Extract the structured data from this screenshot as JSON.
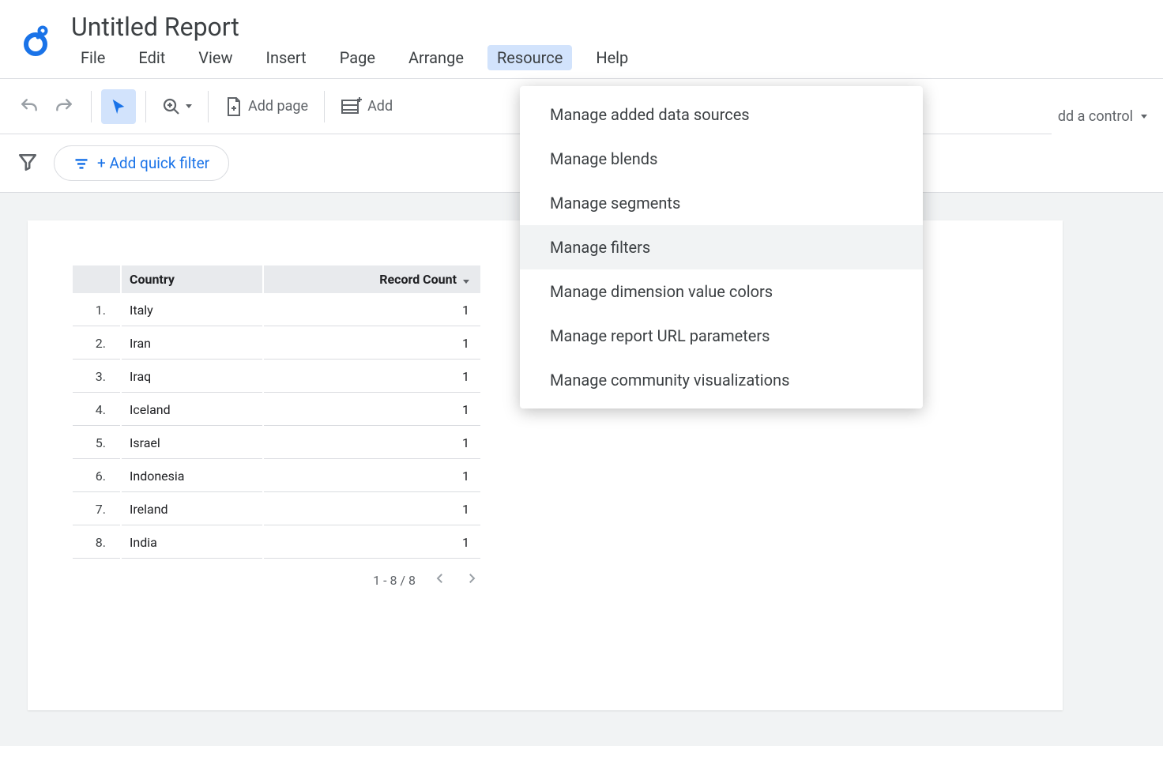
{
  "header": {
    "doc_title": "Untitled Report",
    "menu": [
      "File",
      "Edit",
      "View",
      "Insert",
      "Page",
      "Arrange",
      "Resource",
      "Help"
    ],
    "active_menu_index": 6
  },
  "toolbar": {
    "add_page": "Add page",
    "add_data_partial": "Add",
    "add_control_partial": "dd a control"
  },
  "filterbar": {
    "add_quick_filter": "+ Add quick filter"
  },
  "dropdown": {
    "items": [
      "Manage added data sources",
      "Manage blends",
      "Manage segments",
      "Manage filters",
      "Manage dimension value colors",
      "Manage report URL parameters",
      "Manage community visualizations"
    ],
    "hover_index": 3
  },
  "chart": {
    "columns": {
      "country": "Country",
      "record_count": "Record Count"
    },
    "rows": [
      {
        "n": "1.",
        "country": "Italy",
        "count": "1"
      },
      {
        "n": "2.",
        "country": "Iran",
        "count": "1"
      },
      {
        "n": "3.",
        "country": "Iraq",
        "count": "1"
      },
      {
        "n": "4.",
        "country": "Iceland",
        "count": "1"
      },
      {
        "n": "5.",
        "country": "Israel",
        "count": "1"
      },
      {
        "n": "6.",
        "country": "Indonesia",
        "count": "1"
      },
      {
        "n": "7.",
        "country": "Ireland",
        "count": "1"
      },
      {
        "n": "8.",
        "country": "India",
        "count": "1"
      }
    ],
    "pager": "1 - 8 / 8"
  }
}
